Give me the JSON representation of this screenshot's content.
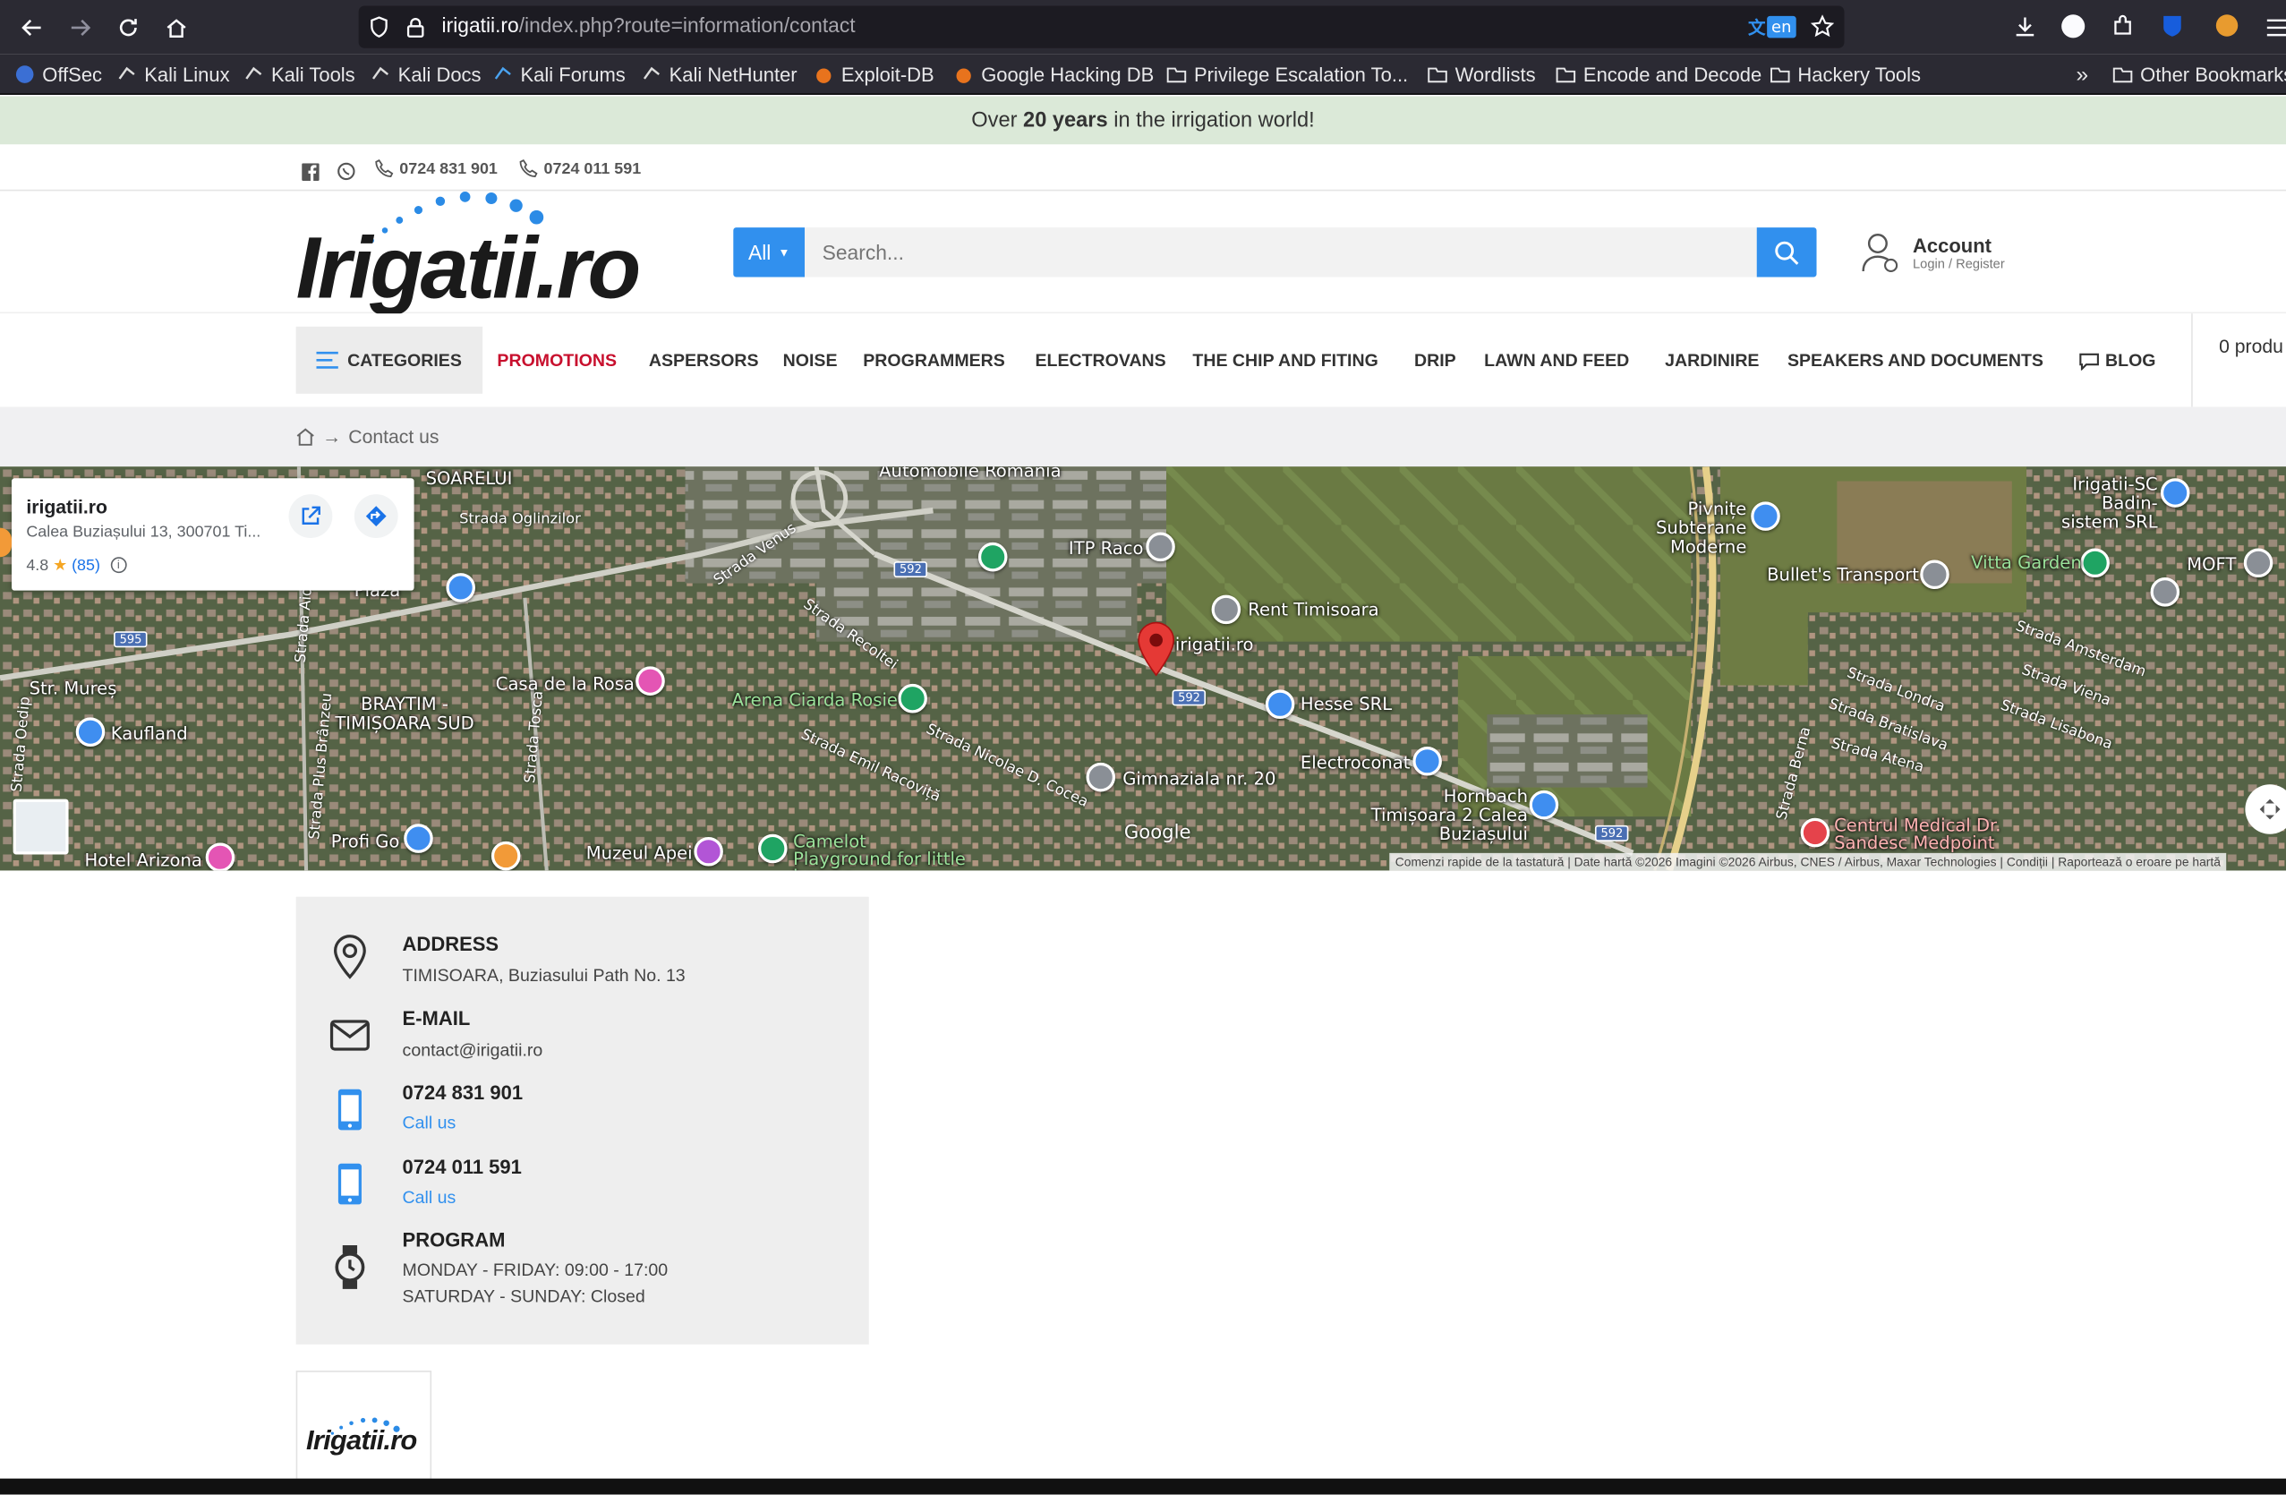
{
  "browser": {
    "url_host": "irigatii.ro",
    "url_path": "/index.php?route=information/contact",
    "translate_lang": "en",
    "bookmarks": [
      "OffSec",
      "Kali Linux",
      "Kali Tools",
      "Kali Docs",
      "Kali Forums",
      "Kali NetHunter",
      "Exploit-DB",
      "Google Hacking DB",
      "Privilege Escalation To...",
      "Wordlists",
      "Encode and Decode",
      "Hackery Tools"
    ],
    "other_bookmarks": "Other Bookmarks"
  },
  "promo": {
    "pre": "Over ",
    "bold": "20 years",
    "post": " in the irrigation world!"
  },
  "topbar": {
    "phone1": "0724 831 901",
    "phone2": "0724 011 591"
  },
  "header": {
    "logo_text": "Irigatii.ro",
    "search_category": "All",
    "search_placeholder": "Search...",
    "account_title": "Account",
    "account_sub": "Login / Register"
  },
  "nav": {
    "categories": "CATEGORIES",
    "items": [
      "PROMOTIONS",
      "ASPERSORS",
      "NOISE",
      "PROGRAMMERS",
      "ELECTROVANS",
      "THE CHIP AND FITING",
      "DRIP",
      "LAWN AND FEED",
      "JARDINIRE",
      "SPEAKERS AND DOCUMENTS",
      "BLOG"
    ],
    "cart": "0 produ"
  },
  "breadcrumb": {
    "current": "Contact us"
  },
  "map": {
    "card_title": "irigatii.ro",
    "card_address": "Calea Buziașului 13, 300701 Ti...",
    "card_rating": "4.8",
    "card_reviews": "(85)",
    "places": [
      "ITP Raco",
      "Rent Timisoara",
      "irigatii.ro",
      "Hesse SRL",
      "Electroconat",
      "Hornbach Timișoara 2 Calea Buziașului",
      "Gimnaziala nr. 20",
      "Pivnițe Subterane Moderne",
      "Bullet's Transport",
      "Vitta Garden",
      "MOFT",
      "Irigatii-SC Badin-sistem SRL",
      "Arena Ciarda Rosie",
      "Casa de la Rosa",
      "Kaufland",
      "BRAYTIM - TIMIȘOARA SUD",
      "Profi Go",
      "Muzeul Apei",
      "Camelot Playground for little heroes",
      "Hotel Arizona",
      "Centrul Medical Dr. Sandesc Medpoint",
      "Str. Mureș",
      "Automobile Romania",
      "SOARELUI"
    ],
    "streets": [
      "Strada Oglinzilor",
      "Strada Venus",
      "Strada Recoltei",
      "Strada Emil Racoviță",
      "Strada Nicolae D. Cocea",
      "Strada Londra",
      "Strada Bratislava",
      "Strada Atena",
      "Strada Amsterdam",
      "Strada Viena",
      "Strada Lisabona",
      "Strada Berna",
      "Strada Plus Brânzeu",
      "Strada Tosca",
      "Strada Aida",
      "Strada Oedip"
    ],
    "route_numbers": [
      "592",
      "595"
    ],
    "google": "Google",
    "attribution": "Comenzi rapide de la tastatură | Date hartă ©2026 Imagini ©2026 Airbus, CNES / Airbus, Maxar Technologies | Condiții | Raportează o eroare pe hartă",
    "card_partial": "Plaza"
  },
  "contact": {
    "address_title": "ADDRESS",
    "address_text": "TIMISOARA, Buziasului Path No. 13",
    "email_title": "E-MAIL",
    "email_text": "contact@irigatii.ro",
    "phone1": "0724 831 901",
    "phone2": "0724 011 591",
    "call_us": "Call us",
    "program_title": "PROGRAM",
    "program_weekdays": "MONDAY - FRIDAY: 09:00 - 17:00",
    "program_weekend": "SATURDAY - SUNDAY: Closed"
  },
  "colors": {
    "accent": "#3190ee",
    "promo_red": "#c8102e",
    "promo_bg": "#dbe9d8",
    "map_pin": "#e53935"
  }
}
